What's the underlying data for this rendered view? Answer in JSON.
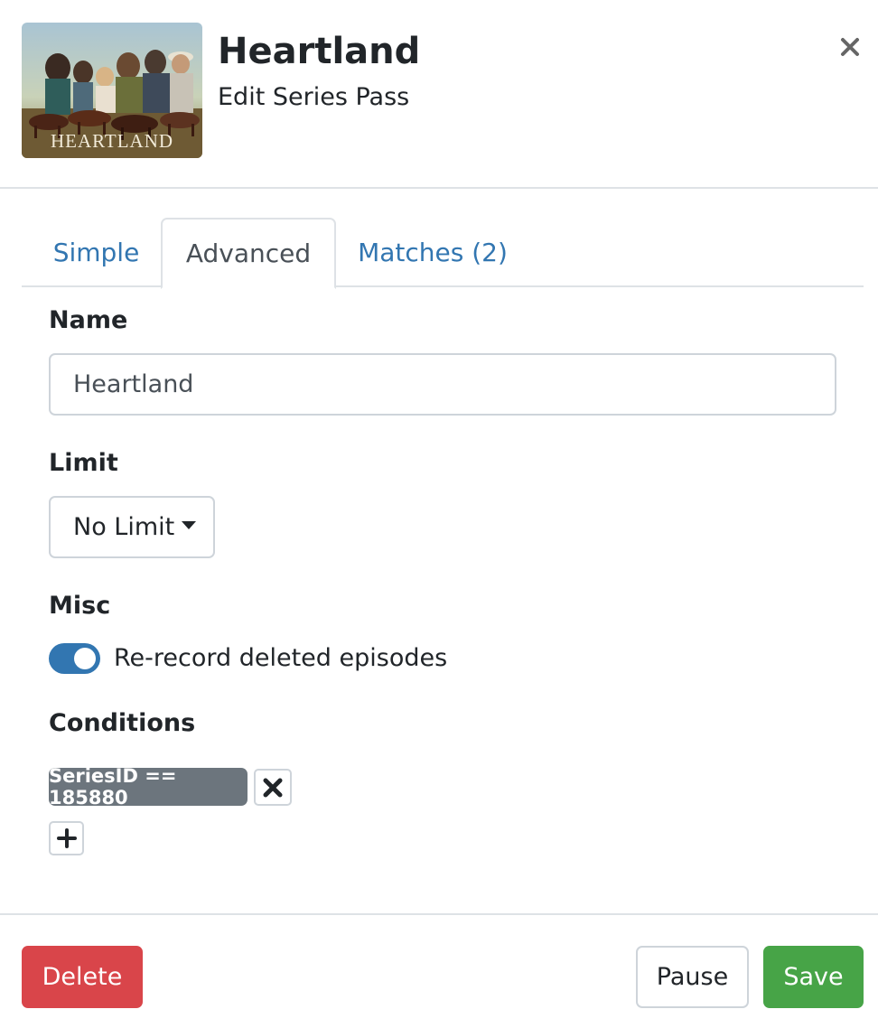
{
  "header": {
    "poster_caption": "HEARTLAND",
    "title": "Heartland",
    "subtitle": "Edit Series Pass"
  },
  "tabs": [
    {
      "label": "Simple",
      "active": false
    },
    {
      "label": "Advanced",
      "active": true
    },
    {
      "label": "Matches (2)",
      "active": false
    }
  ],
  "form": {
    "name_label": "Name",
    "name_value": "Heartland",
    "limit_label": "Limit",
    "limit_value": "No Limit",
    "misc_label": "Misc",
    "rerecord_label": "Re-record deleted episodes",
    "rerecord_enabled": true,
    "conditions_label": "Conditions",
    "conditions": [
      "SeriesID == 185880"
    ]
  },
  "footer": {
    "delete_label": "Delete",
    "pause_label": "Pause",
    "save_label": "Save"
  },
  "colors": {
    "link": "#3276b1",
    "danger": "#d9454a",
    "success": "#47a447",
    "badge": "#6c757d",
    "toggle_on": "#3276b1"
  },
  "icons": {
    "close": "close-icon",
    "caret": "caret-down-icon",
    "remove": "remove-condition-icon",
    "add": "plus-icon"
  }
}
